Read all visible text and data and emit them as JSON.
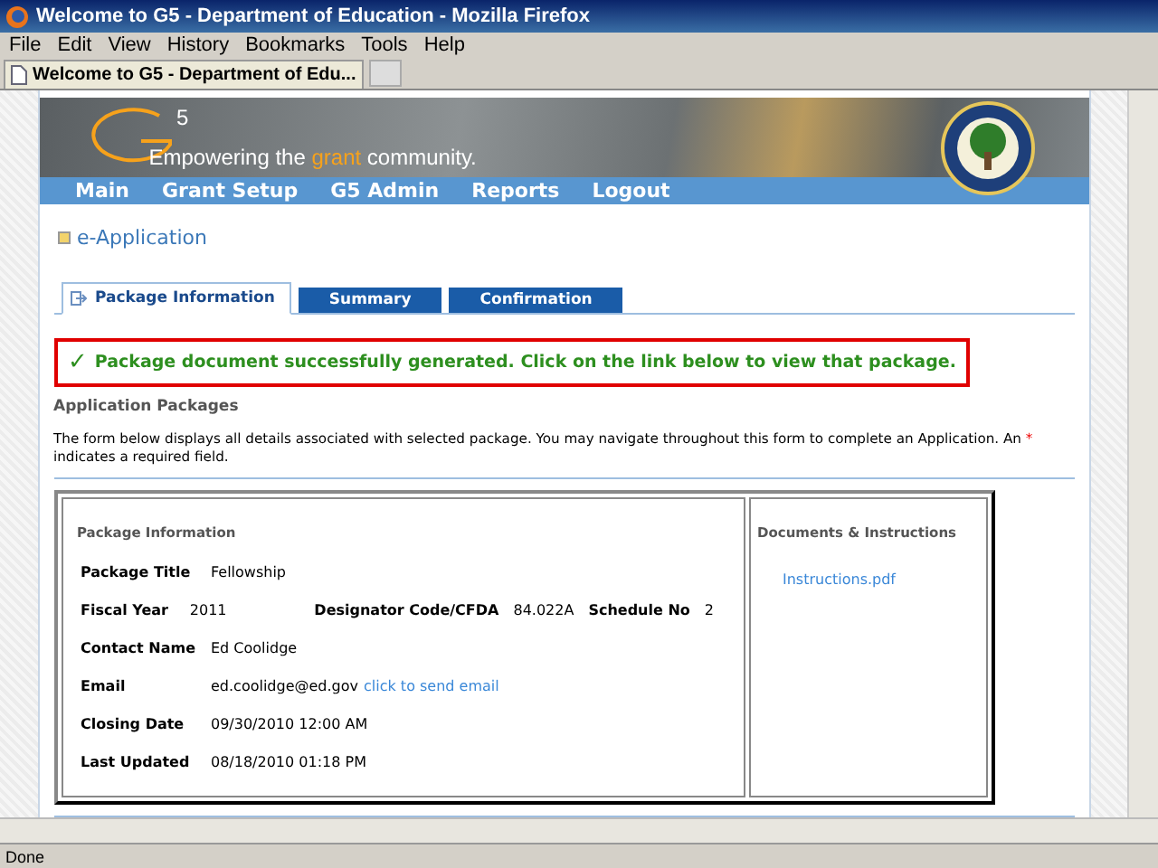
{
  "window": {
    "title": "Welcome to G5 - Department of Education - Mozilla Firefox"
  },
  "menu": [
    "File",
    "Edit",
    "View",
    "History",
    "Bookmarks",
    "Tools",
    "Help"
  ],
  "browser_tab": {
    "title": "Welcome to G5 - Department of Edu..."
  },
  "banner": {
    "logo_superscript": "5",
    "tagline": [
      {
        "text": "Empowering the ",
        "highlight": false
      },
      {
        "text": "grant",
        "highlight": true
      },
      {
        "text": " community.",
        "highlight": false
      }
    ]
  },
  "nav": [
    "Main",
    "Grant Setup",
    "G5 Admin",
    "Reports",
    "Logout"
  ],
  "page_title": "e-Application",
  "tabs": [
    {
      "label": "Package Information",
      "selected": true
    },
    {
      "label": "Summary",
      "selected": false
    },
    {
      "label": "Confirmation",
      "selected": false
    }
  ],
  "message": {
    "kind": "success",
    "icon": "✓",
    "text": "Package document successfully generated. Click on the link below to view that package."
  },
  "section_heading": "Application Packages",
  "intro": {
    "before": "The form below displays all details associated with selected package. You may navigate throughout this form to complete an Application. An ",
    "required_mark": "*",
    "after": " indicates a required field."
  },
  "package": {
    "heading": "Package Information",
    "rows": [
      [
        {
          "label": "Package Title",
          "value": "Fellowship"
        }
      ],
      [
        {
          "label": "Fiscal Year",
          "value": "2011"
        },
        {
          "label": "Designator Code/CFDA",
          "value": "84.022A"
        },
        {
          "label": "Schedule No",
          "value": "2"
        }
      ],
      [
        {
          "label": "Contact Name",
          "value": "Ed Coolidge"
        }
      ],
      [
        {
          "label": "Email",
          "value": "ed.coolidge@ed.gov",
          "link": "click to send email"
        }
      ],
      [
        {
          "label": "Closing Date",
          "value": "09/30/2010 12:00 AM"
        }
      ],
      [
        {
          "label": "Last Updated",
          "value": "08/18/2010 01:18 PM"
        }
      ]
    ]
  },
  "documents": {
    "heading": "Documents & Instructions",
    "links": [
      "Instructions.pdf"
    ]
  },
  "status_bar": {
    "text": "Done"
  }
}
